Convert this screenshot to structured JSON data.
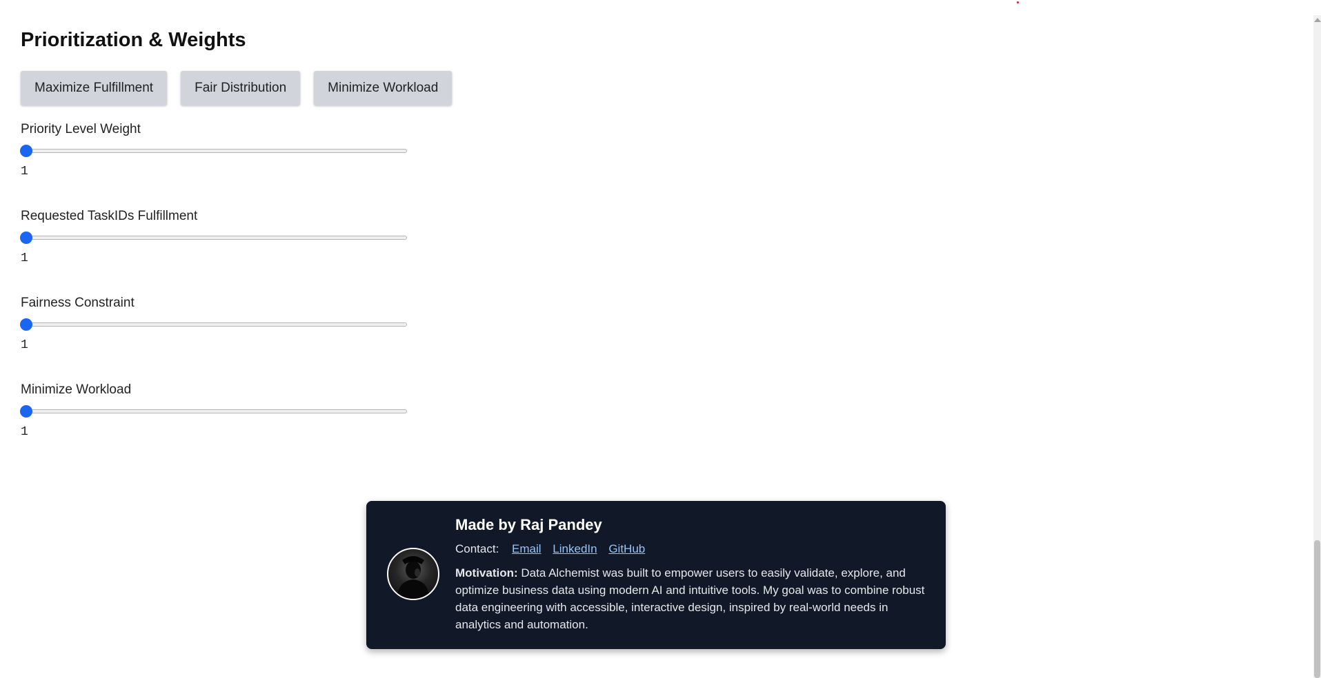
{
  "section": {
    "title": "Prioritization & Weights"
  },
  "presets": [
    {
      "label": "Maximize Fulfillment"
    },
    {
      "label": "Fair Distribution"
    },
    {
      "label": "Minimize Workload"
    }
  ],
  "weights": [
    {
      "label": "Priority Level Weight",
      "value": "1",
      "min": 1,
      "max": 10
    },
    {
      "label": "Requested TaskIDs Fulfillment",
      "value": "1",
      "min": 1,
      "max": 10
    },
    {
      "label": "Fairness Constraint",
      "value": "1",
      "min": 1,
      "max": 10
    },
    {
      "label": "Minimize Workload",
      "value": "1",
      "min": 1,
      "max": 10
    }
  ],
  "footer": {
    "title": "Made by Raj Pandey",
    "contact_label": "Contact:",
    "links": {
      "email": "Email",
      "linkedin": "LinkedIn",
      "github": "GitHub"
    },
    "motivation_label": "Motivation:",
    "motivation_text": "Data Alchemist was built to empower users to easily validate, explore, and optimize business data using modern AI and intuitive tools. My goal was to combine robust data engineering with accessible, interactive design, inspired by real-world needs in analytics and automation."
  },
  "colors": {
    "accent": "#1a66f0",
    "button_bg": "#d1d5db",
    "card_bg": "#111827",
    "link": "#93c5fd"
  }
}
